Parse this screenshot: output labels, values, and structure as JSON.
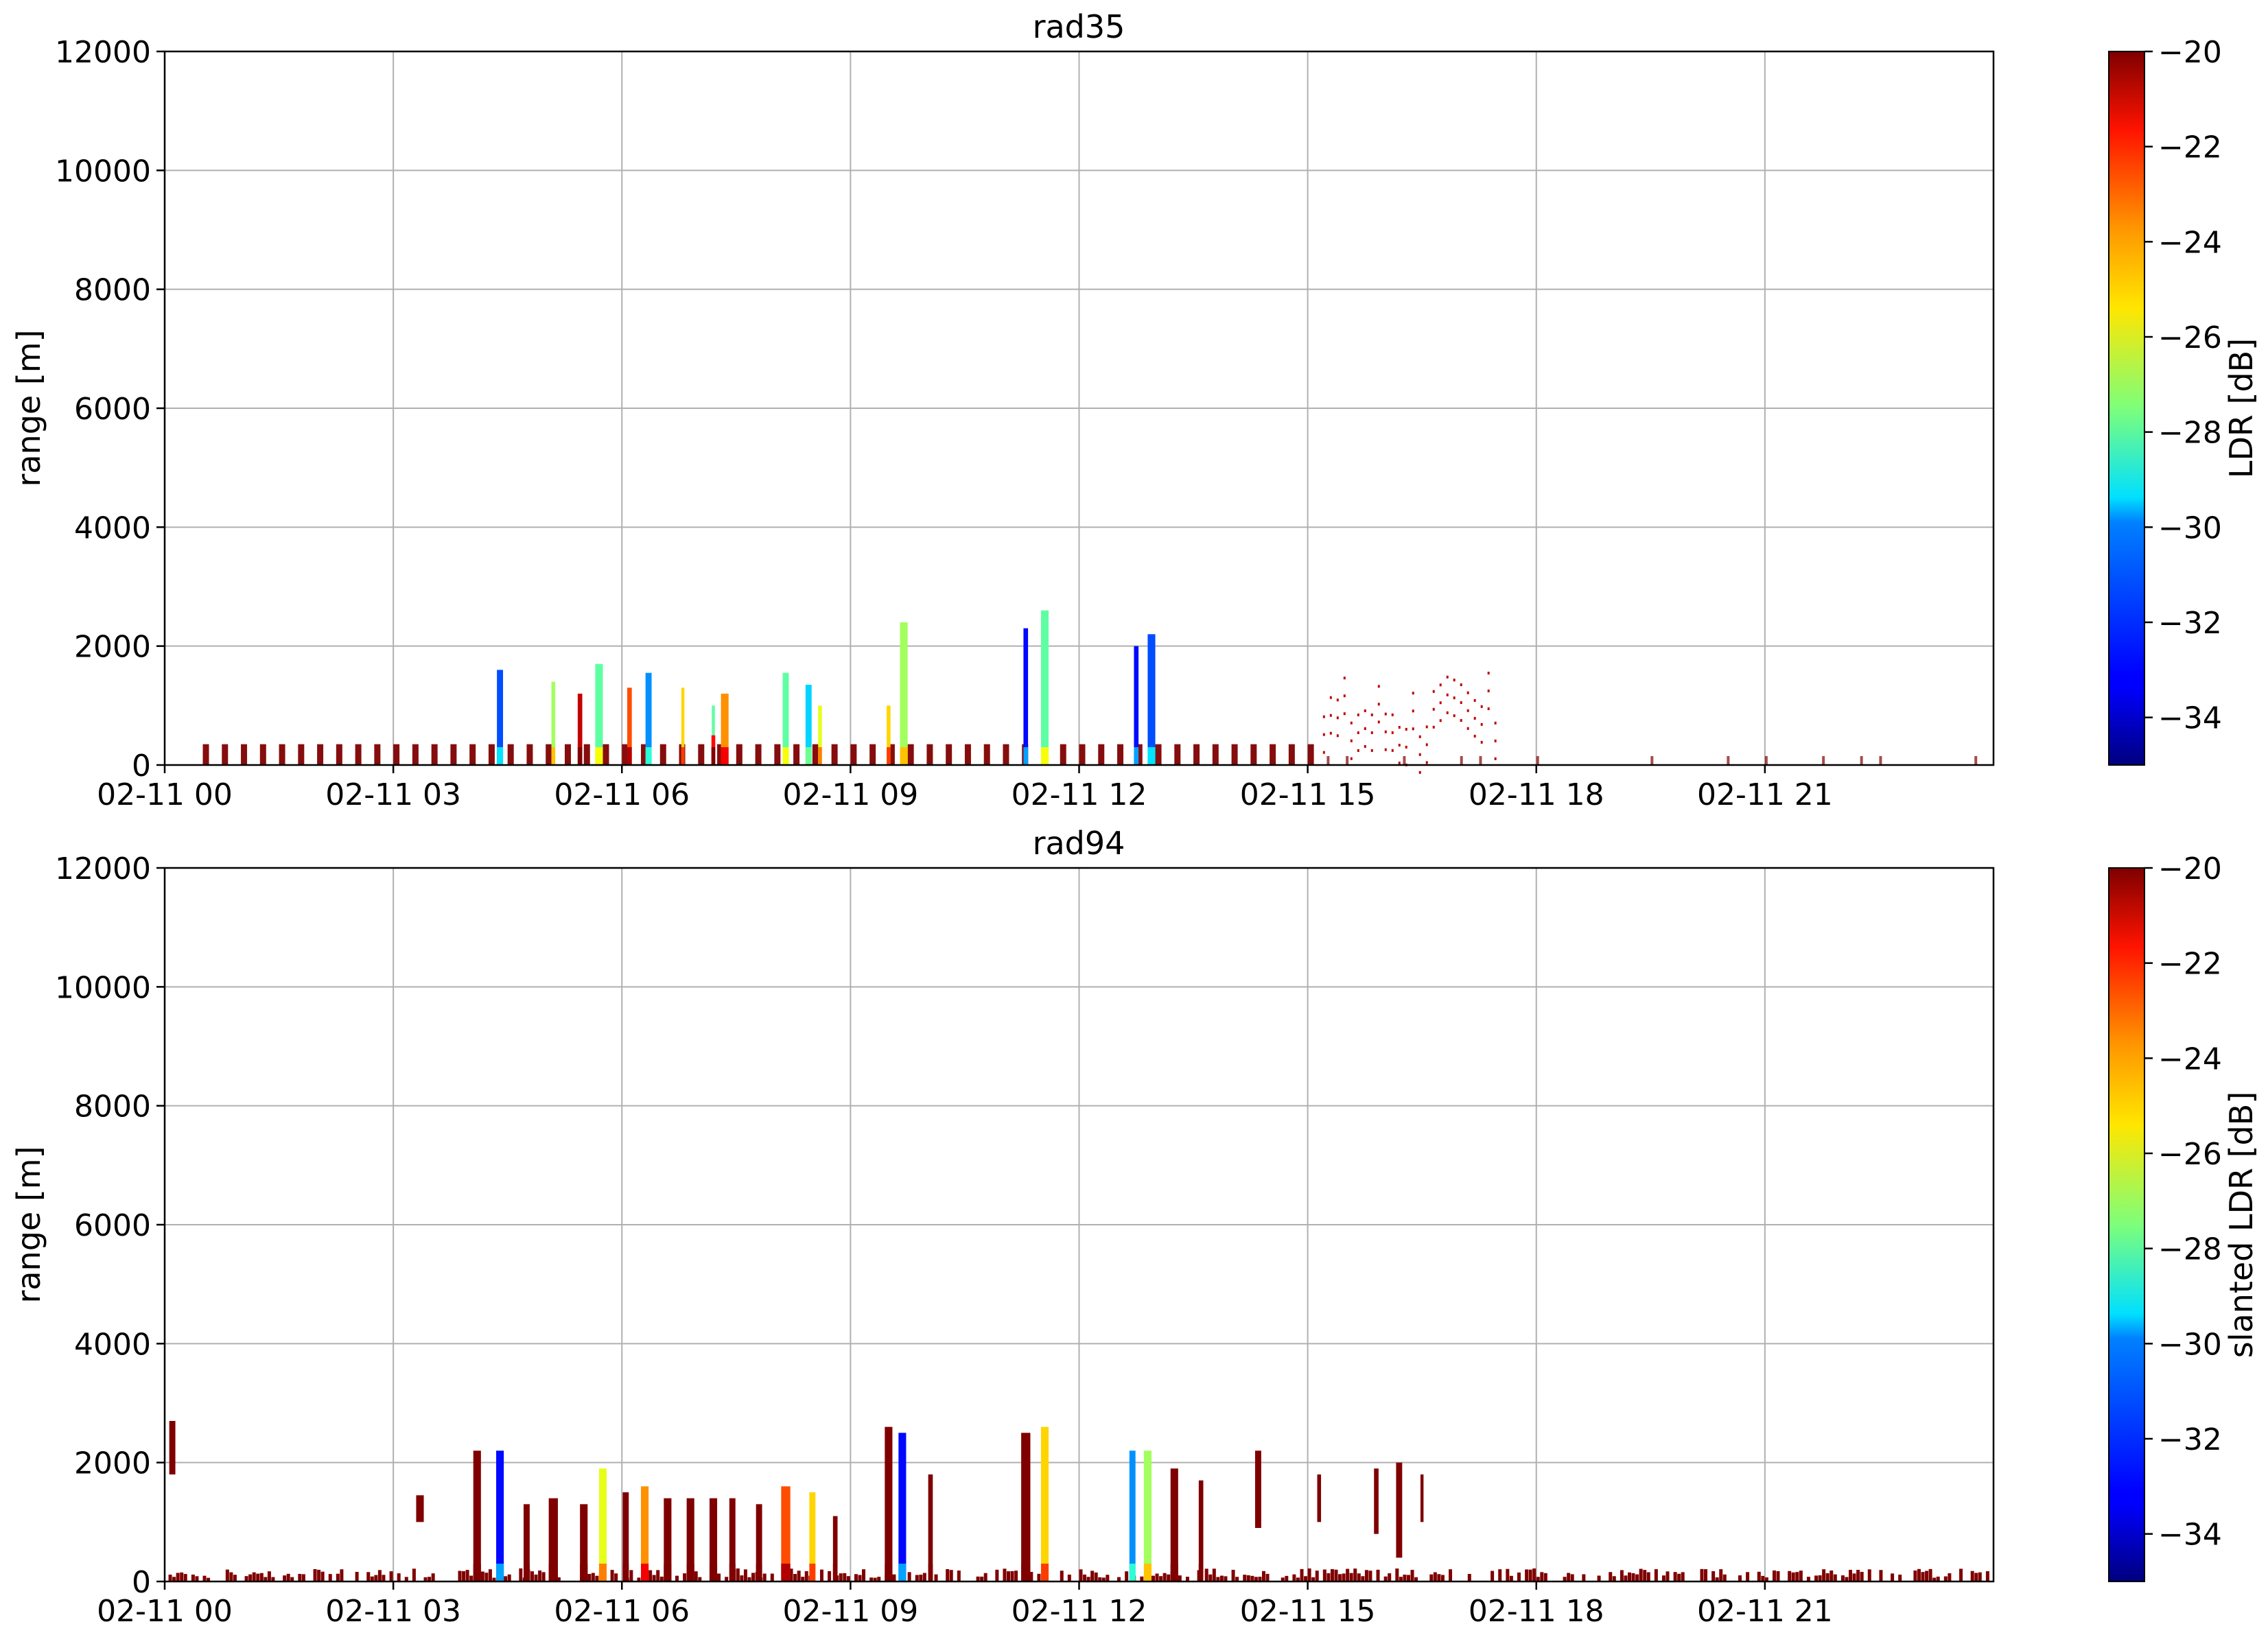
{
  "chart_data": [
    {
      "type": "heatmap",
      "title": "rad35",
      "ylabel": "range [m]",
      "xlabel": "",
      "ylim": [
        0,
        12000
      ],
      "y_ticks": [
        0,
        2000,
        4000,
        6000,
        8000,
        10000,
        12000
      ],
      "x_tick_labels": [
        "02-11 00",
        "02-11 03",
        "02-11 06",
        "02-11 09",
        "02-11 12",
        "02-11 15",
        "02-11 18",
        "02-11 21"
      ],
      "xlim_hours": [
        0,
        24
      ],
      "grid": true,
      "colorbar": {
        "label": "LDR [dB]",
        "range": [
          -35,
          -20
        ],
        "ticks": [
          -20,
          -22,
          -24,
          -26,
          -28,
          -30,
          -32,
          -34
        ],
        "colormap": "jet"
      },
      "features": [
        {
          "hour": 4.4,
          "width_h": 0.08,
          "top": 1600,
          "ldr": -32
        },
        {
          "hour": 5.1,
          "width_h": 0.05,
          "top": 1400,
          "ldr": -27
        },
        {
          "hour": 5.45,
          "width_h": 0.06,
          "top": 1200,
          "ldr": -21
        },
        {
          "hour": 5.7,
          "width_h": 0.1,
          "top": 1700,
          "ldr": -28
        },
        {
          "hour": 6.1,
          "width_h": 0.06,
          "top": 1300,
          "ldr": -23
        },
        {
          "hour": 6.35,
          "width_h": 0.08,
          "top": 1550,
          "ldr": -31
        },
        {
          "hour": 6.8,
          "width_h": 0.04,
          "top": 1300,
          "ldr": -25
        },
        {
          "hour": 7.2,
          "width_h": 0.04,
          "top": 1000,
          "ldr": -28
        },
        {
          "hour": 7.2,
          "width_h": 0.05,
          "top": 500,
          "ldr": -22
        },
        {
          "hour": 7.35,
          "width_h": 0.1,
          "top": 1200,
          "ldr": -24
        },
        {
          "hour": 8.15,
          "width_h": 0.08,
          "top": 1550,
          "ldr": -28
        },
        {
          "hour": 8.45,
          "width_h": 0.08,
          "top": 1350,
          "ldr": -30
        },
        {
          "hour": 8.6,
          "width_h": 0.05,
          "top": 1000,
          "ldr": -26
        },
        {
          "hour": 9.5,
          "width_h": 0.05,
          "top": 1000,
          "ldr": -25
        },
        {
          "hour": 9.7,
          "width_h": 0.1,
          "top": 2400,
          "ldr": -27
        },
        {
          "hour": 11.3,
          "width_h": 0.06,
          "top": 2300,
          "ldr": -33
        },
        {
          "hour": 11.55,
          "width_h": 0.1,
          "top": 2600,
          "ldr": -28
        },
        {
          "hour": 12.75,
          "width_h": 0.06,
          "top": 2000,
          "ldr": -33
        },
        {
          "hour": 12.95,
          "width_h": 0.1,
          "top": 2200,
          "ldr": -32
        }
      ]
    },
    {
      "type": "heatmap",
      "title": "rad94",
      "ylabel": "range [m]",
      "xlabel": "",
      "ylim": [
        0,
        12000
      ],
      "y_ticks": [
        0,
        2000,
        4000,
        6000,
        8000,
        10000,
        12000
      ],
      "x_tick_labels": [
        "02-11 00",
        "02-11 03",
        "02-11 06",
        "02-11 09",
        "02-11 12",
        "02-11 15",
        "02-11 18",
        "02-11 21"
      ],
      "xlim_hours": [
        0,
        24
      ],
      "grid": true,
      "colorbar": {
        "label": "slanted LDR [dB]",
        "range": [
          -35,
          -20
        ],
        "ticks": [
          -20,
          -22,
          -24,
          -26,
          -28,
          -30,
          -32,
          -34
        ],
        "colormap": "jet"
      },
      "features": [
        {
          "hour": 0.1,
          "width_h": 0.08,
          "bottom": 1800,
          "top": 2700,
          "ldr": -20
        },
        {
          "hour": 3.35,
          "width_h": 0.1,
          "bottom": 1000,
          "top": 1450,
          "ldr": -20
        },
        {
          "hour": 4.1,
          "width_h": 0.1,
          "bottom": 0,
          "top": 2200,
          "ldr": -20
        },
        {
          "hour": 4.4,
          "width_h": 0.1,
          "bottom": 0,
          "top": 2200,
          "ldr": -33
        },
        {
          "hour": 4.75,
          "width_h": 0.08,
          "bottom": 0,
          "top": 1300,
          "ldr": -20
        },
        {
          "hour": 5.1,
          "width_h": 0.12,
          "bottom": 0,
          "top": 1400,
          "ldr": -20
        },
        {
          "hour": 5.5,
          "width_h": 0.1,
          "bottom": 0,
          "top": 1300,
          "ldr": -20
        },
        {
          "hour": 5.75,
          "width_h": 0.1,
          "bottom": 0,
          "top": 1900,
          "ldr": -26
        },
        {
          "hour": 6.05,
          "width_h": 0.08,
          "bottom": 0,
          "top": 1500,
          "ldr": -20
        },
        {
          "hour": 6.3,
          "width_h": 0.1,
          "bottom": 0,
          "top": 1600,
          "ldr": -24
        },
        {
          "hour": 6.6,
          "width_h": 0.1,
          "bottom": 0,
          "top": 1400,
          "ldr": -20
        },
        {
          "hour": 6.9,
          "width_h": 0.1,
          "bottom": 0,
          "top": 1400,
          "ldr": -20
        },
        {
          "hour": 7.2,
          "width_h": 0.1,
          "bottom": 0,
          "top": 1400,
          "ldr": -20
        },
        {
          "hour": 7.45,
          "width_h": 0.08,
          "bottom": 0,
          "top": 1400,
          "ldr": -20
        },
        {
          "hour": 7.8,
          "width_h": 0.08,
          "bottom": 0,
          "top": 1300,
          "ldr": -20
        },
        {
          "hour": 8.15,
          "width_h": 0.12,
          "bottom": 0,
          "top": 1600,
          "ldr": -23
        },
        {
          "hour": 8.5,
          "width_h": 0.08,
          "bottom": 0,
          "top": 1500,
          "ldr": -25
        },
        {
          "hour": 8.8,
          "width_h": 0.06,
          "bottom": 0,
          "top": 1100,
          "ldr": -20
        },
        {
          "hour": 9.5,
          "width_h": 0.1,
          "bottom": 0,
          "top": 2600,
          "ldr": -20
        },
        {
          "hour": 9.68,
          "width_h": 0.1,
          "bottom": 0,
          "top": 2500,
          "ldr": -33
        },
        {
          "hour": 10.05,
          "width_h": 0.06,
          "bottom": 0,
          "top": 1800,
          "ldr": -20
        },
        {
          "hour": 11.3,
          "width_h": 0.12,
          "bottom": 0,
          "top": 2500,
          "ldr": -20
        },
        {
          "hour": 11.55,
          "width_h": 0.1,
          "bottom": 0,
          "top": 2600,
          "ldr": -25
        },
        {
          "hour": 12.7,
          "width_h": 0.08,
          "bottom": 0,
          "top": 2200,
          "ldr": -31
        },
        {
          "hour": 12.9,
          "width_h": 0.1,
          "bottom": 0,
          "top": 2200,
          "ldr": -27
        },
        {
          "hour": 13.25,
          "width_h": 0.1,
          "bottom": 0,
          "top": 1900,
          "ldr": -20
        },
        {
          "hour": 13.6,
          "width_h": 0.06,
          "bottom": 0,
          "top": 1700,
          "ldr": -20
        },
        {
          "hour": 14.35,
          "width_h": 0.08,
          "bottom": 900,
          "top": 2200,
          "ldr": -20
        },
        {
          "hour": 15.15,
          "width_h": 0.05,
          "bottom": 1000,
          "top": 1800,
          "ldr": -20
        },
        {
          "hour": 15.9,
          "width_h": 0.06,
          "bottom": 800,
          "top": 1900,
          "ldr": -20
        },
        {
          "hour": 16.2,
          "width_h": 0.08,
          "bottom": 400,
          "top": 2000,
          "ldr": -20
        },
        {
          "hour": 16.5,
          "width_h": 0.04,
          "bottom": 1000,
          "top": 1800,
          "ldr": -20
        }
      ]
    }
  ]
}
